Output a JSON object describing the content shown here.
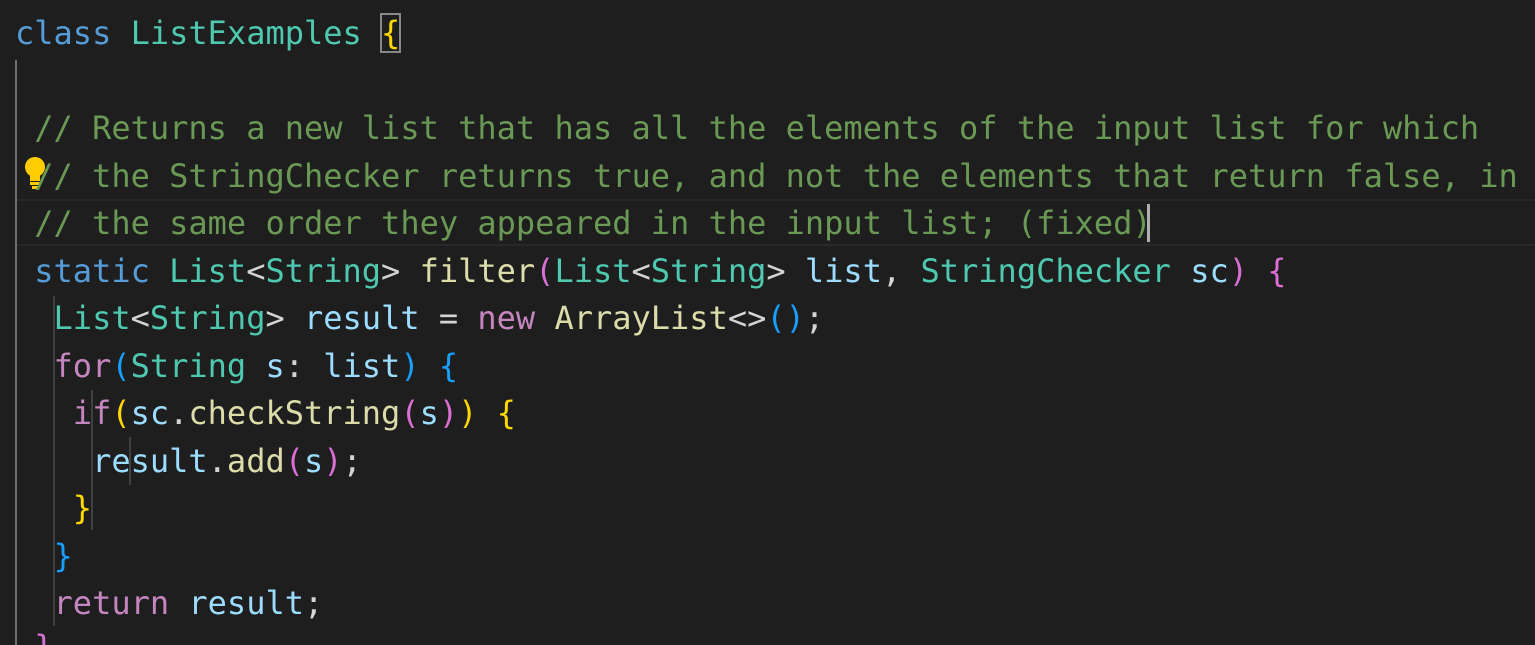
{
  "editor": {
    "code": {
      "line1": {
        "kw": "class",
        "name": "ListExamples",
        "open": "{"
      },
      "line3": {
        "comment": "// Returns a new list that has all the elements of the input list for which"
      },
      "line4": {
        "comment": "// the StringChecker returns true, and not the elements that return false, in"
      },
      "line5": {
        "comment": "// the same order they appeared in the input list; (fixed)"
      },
      "line6": {
        "static": "static",
        "type1": "List",
        "lt1": "<",
        "type2": "String",
        "gt1": ">",
        "fn": "filter",
        "p_open": "(",
        "type3": "List",
        "lt2": "<",
        "type4": "String",
        "gt2": ">",
        "param1": "list",
        "comma": ",",
        "type5": "StringChecker",
        "param2": "sc",
        "p_close": ")",
        "brace": "{"
      },
      "line7": {
        "type1": "List",
        "lt": "<",
        "type2": "String",
        "gt": ">",
        "var": "result",
        "eq": "=",
        "new": "new",
        "ctor": "ArrayList",
        "diamond": "<>",
        "paren": "()",
        "semi": ";"
      },
      "line8": {
        "for": "for",
        "p_open": "(",
        "type": "String",
        "var": "s",
        "colon": ":",
        "iter": "list",
        "p_close": ")",
        "brace": "{"
      },
      "line9": {
        "if": "if",
        "p_open": "(",
        "obj": "sc",
        "dot": ".",
        "method": "checkString",
        "p_inner_open": "(",
        "arg": "s",
        "p_inner_close": ")",
        "p_close": ")",
        "brace": "{"
      },
      "line10": {
        "obj": "result",
        "dot": ".",
        "method": "add",
        "p_open": "(",
        "arg": "s",
        "p_close": ")",
        "semi": ";"
      },
      "line11": {
        "brace": "}"
      },
      "line12": {
        "brace": "}"
      },
      "line13": {
        "kw": "return",
        "var": "result",
        "semi": ";"
      },
      "line14": {
        "brace": "}"
      }
    },
    "colors": {
      "background": "#1e1e1e",
      "keyword": "#569cd6",
      "control": "#c586c0",
      "type": "#4ec9b0",
      "function": "#dcdcaa",
      "variable": "#9cdcfe",
      "comment": "#6a9955",
      "bracket_level1": "#ffd700",
      "bracket_level2": "#da70d6",
      "bracket_level3": "#179fff"
    },
    "icons": {
      "code_action": "lightbulb-icon"
    }
  }
}
